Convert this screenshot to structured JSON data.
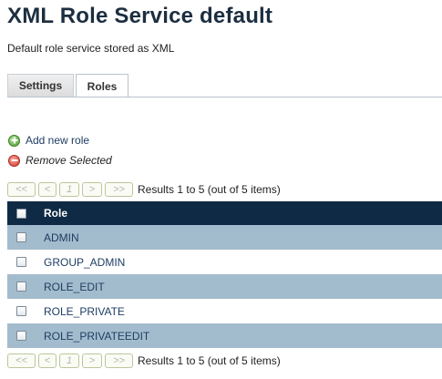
{
  "page": {
    "title": "XML Role Service default",
    "subtitle": "Default role service stored as XML"
  },
  "tabs": [
    {
      "label": "Settings",
      "active": false
    },
    {
      "label": "Roles",
      "active": true
    }
  ],
  "actions": {
    "add_label": "Add new role",
    "remove_label": "Remove Selected"
  },
  "pager": {
    "first": "<<",
    "prev": "<",
    "page": "1",
    "next": ">",
    "last": ">>",
    "results": "Results 1 to 5 (out of 5 items)"
  },
  "table": {
    "header": "Role",
    "rows": [
      "ADMIN",
      "GROUP_ADMIN",
      "ROLE_EDIT",
      "ROLE_PRIVATE",
      "ROLE_PRIVATEEDIT"
    ]
  },
  "colors": {
    "header_bg": "#0f2a44",
    "row_alt_bg": "#a3bccd",
    "link": "#1f3d63"
  },
  "icons": {
    "add": "add-icon",
    "remove": "remove-icon"
  }
}
